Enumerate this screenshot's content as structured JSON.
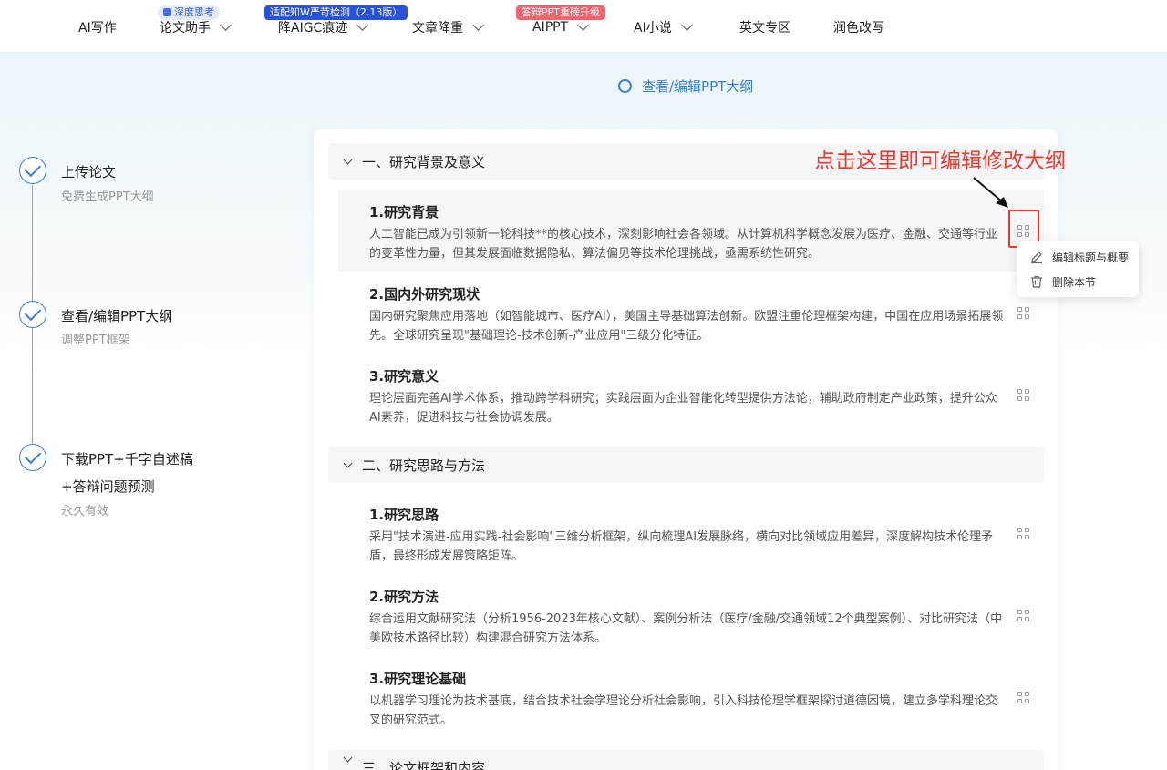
{
  "nav": {
    "items": [
      {
        "label": "AI写作",
        "dropdown": false
      },
      {
        "label": "论文助手",
        "dropdown": true,
        "badge": "深度思考"
      },
      {
        "label": "降AIGC痕迹",
        "dropdown": true,
        "badge": "适配知W严苛检测（2.13版）"
      },
      {
        "label": "文章降重",
        "dropdown": true
      },
      {
        "label": "AIPPT",
        "dropdown": true,
        "badge": "答辩PPT重磅升级"
      },
      {
        "label": "AI小说",
        "dropdown": true
      },
      {
        "label": "英文专区",
        "dropdown": false
      },
      {
        "label": "润色改写",
        "dropdown": false
      }
    ]
  },
  "step_header": "查看/编辑PPT大纲",
  "steps": [
    {
      "label": "上传论文",
      "sub": "免费生成PPT大纲"
    },
    {
      "label": "查看/编辑PPT大纲",
      "sub": "调整PPT框架"
    },
    {
      "label": "下载PPT+千字自述稿",
      "label2": "+答辩问题预测",
      "sub": "永久有效"
    }
  ],
  "sections": [
    {
      "title": "一、研究背景及意义",
      "items": [
        {
          "title": "1.研究背景",
          "text": "人工智能已成为引领新一轮科技**的核心技术，深刻影响社会各领域。从计算机科学概念发展为医疗、金融、交通等行业的变革性力量，但其发展面临数据隐私、算法偏见等技术伦理挑战，亟需系统性研究。"
        },
        {
          "title": "2.国内外研究现状",
          "text": "国内研究聚焦应用落地（如智能城市、医疗AI），美国主导基础算法创新。欧盟注重伦理框架构建，中国在应用场景拓展领先。全球研究呈现\"基础理论-技术创新-产业应用\"三级分化特征。"
        },
        {
          "title": "3.研究意义",
          "text": "理论层面完善AI学术体系，推动跨学科研究；实践层面为企业智能化转型提供方法论，辅助政府制定产业政策，提升公众AI素养，促进科技与社会协调发展。"
        }
      ]
    },
    {
      "title": "二、研究思路与方法",
      "items": [
        {
          "title": "1.研究思路",
          "text": "采用\"技术演进-应用实践-社会影响\"三维分析框架，纵向梳理AI发展脉络，横向对比领域应用差异，深度解构技术伦理矛盾，最终形成发展策略矩阵。"
        },
        {
          "title": "2.研究方法",
          "text": "综合运用文献研究法（分析1956-2023年核心文献）、案例分析法（医疗/金融/交通领域12个典型案例）、对比研究法（中美欧技术路径比较）构建混合研究方法体系。"
        },
        {
          "title": "3.研究理论基础",
          "text": "以机器学习理论为技术基底，结合技术社会学理论分析社会影响，引入科技伦理学框架探讨道德困境，建立多学科理论交叉的研究范式。"
        }
      ]
    },
    {
      "title": "三、论文框架和内容",
      "items": []
    }
  ],
  "annotation": "点击这里即可编辑修改大纲",
  "menu": {
    "edit_label": "编辑标题与概要",
    "delete_label": "删除本节"
  },
  "colors": {
    "accent": "#2f7fe0",
    "annotation": "#f03a2e"
  }
}
